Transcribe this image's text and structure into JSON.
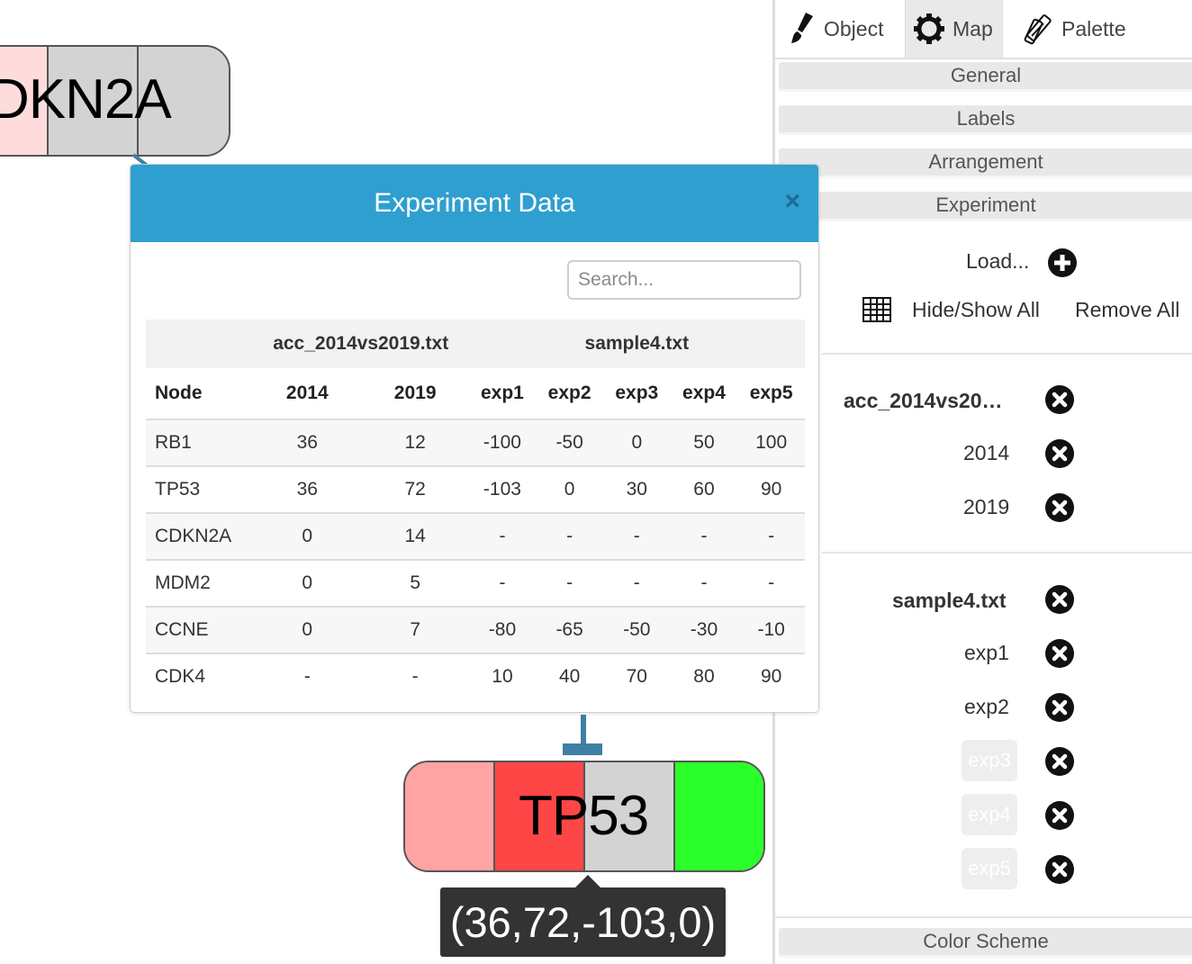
{
  "canvas": {
    "cdkn2a_node": {
      "label": "DKN2A"
    },
    "tp53_node": {
      "label": "TP53"
    },
    "tooltip": "(36,72,-103,0)"
  },
  "dialog": {
    "title": "Experiment Data",
    "close_glyph": "×",
    "search_placeholder": "Search...",
    "file_headers": [
      "acc_2014vs2019.txt",
      "sample4.txt"
    ],
    "columns": [
      "Node",
      "2014",
      "2019",
      "exp1",
      "exp2",
      "exp3",
      "exp4",
      "exp5"
    ],
    "rows": [
      [
        "RB1",
        "36",
        "12",
        "-100",
        "-50",
        "0",
        "50",
        "100"
      ],
      [
        "TP53",
        "36",
        "72",
        "-103",
        "0",
        "30",
        "60",
        "90"
      ],
      [
        "CDKN2A",
        "0",
        "14",
        "-",
        "-",
        "-",
        "-",
        "-"
      ],
      [
        "MDM2",
        "0",
        "5",
        "-",
        "-",
        "-",
        "-",
        "-"
      ],
      [
        "CCNE",
        "0",
        "7",
        "-80",
        "-65",
        "-50",
        "-30",
        "-10"
      ],
      [
        "CDK4",
        "-",
        "-",
        "10",
        "40",
        "70",
        "80",
        "90"
      ]
    ]
  },
  "panel": {
    "tabs": [
      "Object",
      "Map",
      "Palette"
    ],
    "sections": {
      "general": "General",
      "labels": "Labels",
      "arrangement": "Arrangement",
      "experiment": "Experiment",
      "color_scheme": "Color Scheme"
    },
    "load_label": "Load...",
    "hide_show_all": "Hide/Show All",
    "remove_all": "Remove All",
    "file1": {
      "name": "acc_2014vs20…",
      "experiments": [
        "2014",
        "2019"
      ]
    },
    "file2": {
      "name": "sample4.txt",
      "experiments": [
        "exp1",
        "exp2"
      ],
      "disabled": [
        "exp3",
        "exp4",
        "exp5"
      ]
    }
  },
  "colors": {
    "header_blue": "#2e9fd0",
    "edge_blue": "#3f7fa6",
    "low_pink": "#ffdcdc",
    "pink": "#ffa3a3",
    "red": "#ff4646",
    "gray": "#d3d3d3",
    "green": "#2bff2b"
  }
}
